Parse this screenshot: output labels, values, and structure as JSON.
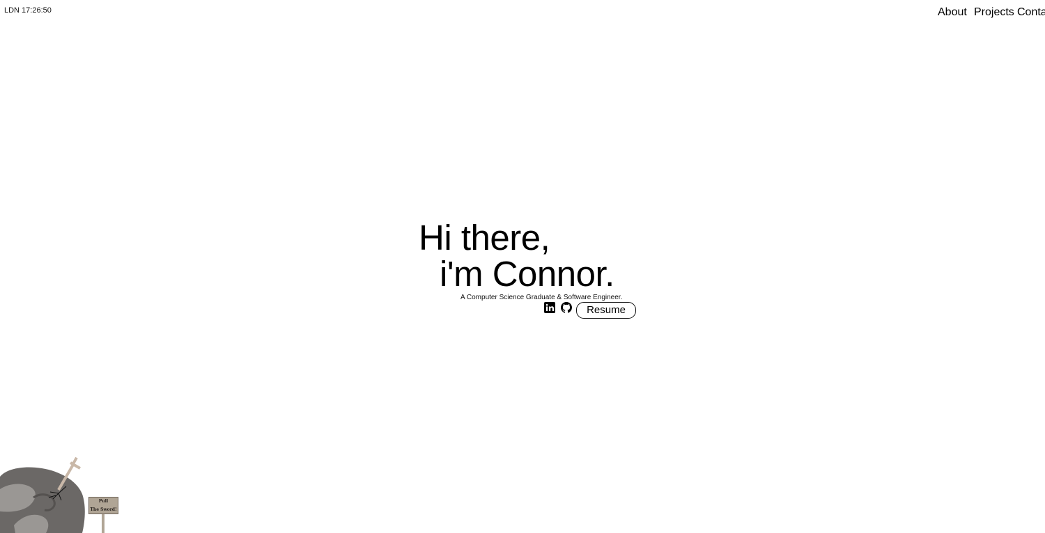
{
  "header": {
    "clock": "LDN 17:26:50",
    "nav": [
      {
        "label": "About"
      },
      {
        "label": "Projects"
      },
      {
        "label": "Contact"
      }
    ]
  },
  "hero": {
    "line1": "Hi there,",
    "line2": "i'm Connor.",
    "subtitle": "A Computer Science Graduate & Software Engineer.",
    "socials": [
      {
        "icon": "linkedin-icon"
      },
      {
        "icon": "github-icon"
      }
    ],
    "resume_label": "Resume"
  },
  "easter_egg": {
    "sign_line1": "Pull",
    "sign_line2": "The Sword!"
  },
  "colors": {
    "background": "#ffffff",
    "text": "#000000",
    "rock_dark": "#6b6866",
    "rock_light": "#9a9794",
    "sword": "#c9b8a8",
    "sign": "#b0a595"
  }
}
